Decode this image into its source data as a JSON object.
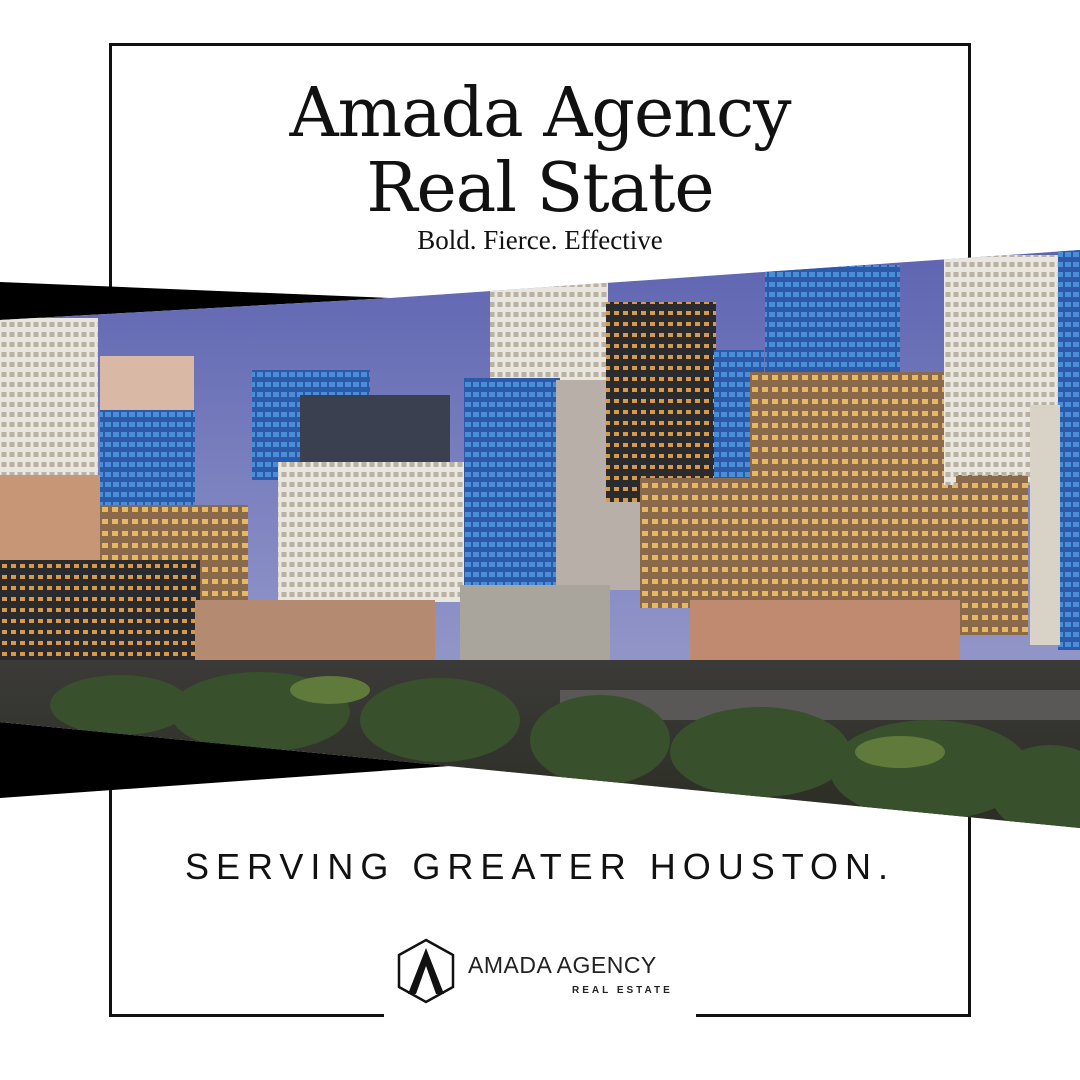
{
  "header": {
    "title_line1": "Amada Agency",
    "title_line2": "Real State",
    "tagline": "Bold. Fierce. Effective"
  },
  "image": {
    "subject": "Houston downtown skyline at dusk"
  },
  "footer": {
    "serving_text": "SERVING GREATER HOUSTON.",
    "logo_name": "AMADA AGENCY",
    "logo_sub": "REAL ESTATE"
  },
  "colors": {
    "ink": "#111111",
    "background": "#ffffff",
    "sky": "#6f74b8"
  }
}
